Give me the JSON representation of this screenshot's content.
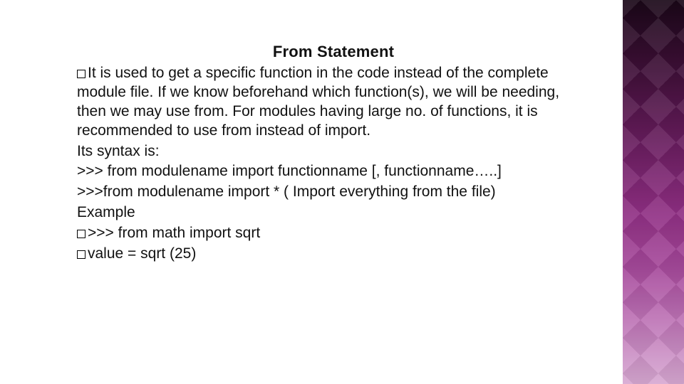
{
  "slide": {
    "title": "From Statement",
    "bullet1": "It is used to get a specific function in the code instead of the complete module file. If we know beforehand which function(s), we will be needing, then we may use from. For modules having large no. of functions, it is recommended to use from instead of import.",
    "line_syntax_label": "Its syntax is:",
    "line_syntax1": ">>> from modulename import functionname [, functionname…..]",
    "line_syntax2": ">>>from modulename import * ( Import everything from the file)",
    "line_example_label": "Example",
    "bullet2": ">>> from math import sqrt",
    "bullet3": "value = sqrt (25)"
  }
}
